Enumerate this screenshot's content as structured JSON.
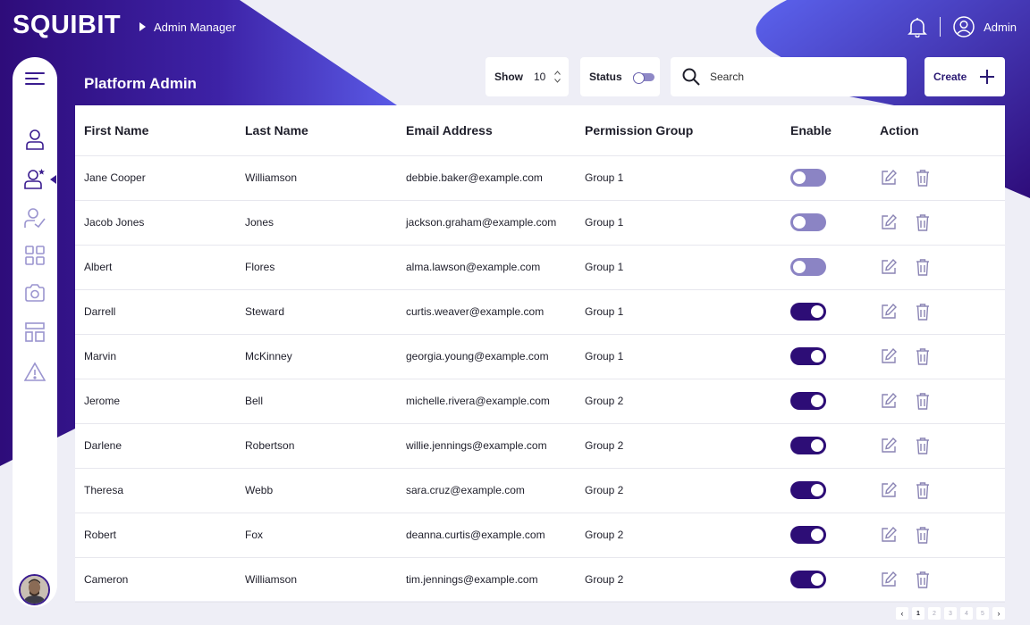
{
  "brand": {
    "logo": "SQUIBIT"
  },
  "breadcrumb": {
    "label": "Admin Manager"
  },
  "topbar": {
    "user_label": "Admin",
    "bell_icon": "bell-icon",
    "user_icon": "user-circle-icon"
  },
  "page": {
    "title": "Platform Admin"
  },
  "controls": {
    "show_label": "Show",
    "show_value": "10",
    "status_label": "Status",
    "search_placeholder": "Search",
    "create_label": "Create"
  },
  "sidebar": {
    "items": [
      {
        "icon": "menu-icon"
      },
      {
        "icon": "user-icon"
      },
      {
        "icon": "user-star-icon",
        "active": true
      },
      {
        "icon": "user-check-icon"
      },
      {
        "icon": "grid-icon"
      },
      {
        "icon": "camera-icon"
      },
      {
        "icon": "layout-icon"
      },
      {
        "icon": "warning-icon"
      }
    ]
  },
  "table": {
    "headers": [
      "First Name",
      "Last Name",
      "Email Address",
      "Permission Group",
      "Enable",
      "Action"
    ],
    "rows": [
      {
        "first": "Jane Cooper",
        "last": "Williamson",
        "email": "debbie.baker@example.com",
        "group": "Group 1",
        "enabled": false
      },
      {
        "first": "Jacob Jones",
        "last": "Jones",
        "email": "jackson.graham@example.com",
        "group": "Group 1",
        "enabled": false
      },
      {
        "first": "Albert",
        "last": "Flores",
        "email": "alma.lawson@example.com",
        "group": "Group 1",
        "enabled": false
      },
      {
        "first": "Darrell",
        "last": "Steward",
        "email": "curtis.weaver@example.com",
        "group": "Group 1",
        "enabled": true
      },
      {
        "first": "Marvin",
        "last": "McKinney",
        "email": "georgia.young@example.com",
        "group": "Group 1",
        "enabled": true
      },
      {
        "first": "Jerome",
        "last": "Bell",
        "email": "michelle.rivera@example.com",
        "group": "Group 2",
        "enabled": true
      },
      {
        "first": "Darlene",
        "last": "Robertson",
        "email": "willie.jennings@example.com",
        "group": "Group 2",
        "enabled": true
      },
      {
        "first": "Theresa",
        "last": "Webb",
        "email": "sara.cruz@example.com",
        "group": "Group 2",
        "enabled": true
      },
      {
        "first": "Robert",
        "last": "Fox",
        "email": "deanna.curtis@example.com",
        "group": "Group 2",
        "enabled": true
      },
      {
        "first": "Cameron",
        "last": "Williamson",
        "email": "tim.jennings@example.com",
        "group": "Group 2",
        "enabled": true
      }
    ]
  },
  "pagination": {
    "prev": "‹",
    "next": "›",
    "pages": [
      "1",
      "2",
      "3",
      "4",
      "5"
    ],
    "current": "1"
  },
  "colors": {
    "primary": "#2d0d76",
    "accent": "#5b63ee",
    "background": "#eeeef6",
    "toggle_off": "#8b84c4"
  }
}
